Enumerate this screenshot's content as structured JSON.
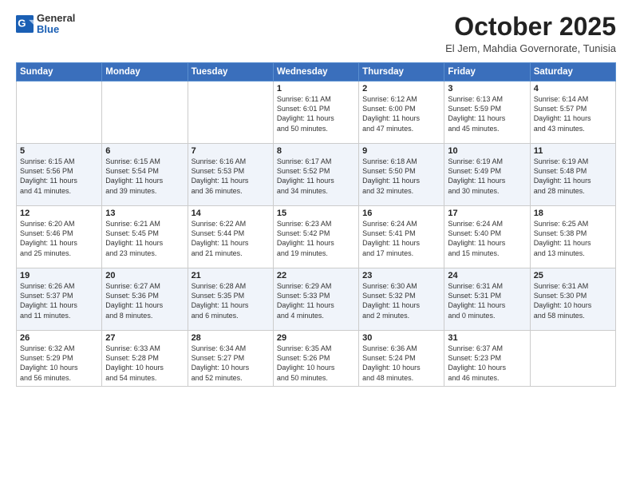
{
  "header": {
    "logo_general": "General",
    "logo_blue": "Blue",
    "month_title": "October 2025",
    "subtitle": "El Jem, Mahdia Governorate, Tunisia"
  },
  "weekdays": [
    "Sunday",
    "Monday",
    "Tuesday",
    "Wednesday",
    "Thursday",
    "Friday",
    "Saturday"
  ],
  "weeks": [
    [
      {
        "day": "",
        "text": ""
      },
      {
        "day": "",
        "text": ""
      },
      {
        "day": "",
        "text": ""
      },
      {
        "day": "1",
        "text": "Sunrise: 6:11 AM\nSunset: 6:01 PM\nDaylight: 11 hours\nand 50 minutes."
      },
      {
        "day": "2",
        "text": "Sunrise: 6:12 AM\nSunset: 6:00 PM\nDaylight: 11 hours\nand 47 minutes."
      },
      {
        "day": "3",
        "text": "Sunrise: 6:13 AM\nSunset: 5:59 PM\nDaylight: 11 hours\nand 45 minutes."
      },
      {
        "day": "4",
        "text": "Sunrise: 6:14 AM\nSunset: 5:57 PM\nDaylight: 11 hours\nand 43 minutes."
      }
    ],
    [
      {
        "day": "5",
        "text": "Sunrise: 6:15 AM\nSunset: 5:56 PM\nDaylight: 11 hours\nand 41 minutes."
      },
      {
        "day": "6",
        "text": "Sunrise: 6:15 AM\nSunset: 5:54 PM\nDaylight: 11 hours\nand 39 minutes."
      },
      {
        "day": "7",
        "text": "Sunrise: 6:16 AM\nSunset: 5:53 PM\nDaylight: 11 hours\nand 36 minutes."
      },
      {
        "day": "8",
        "text": "Sunrise: 6:17 AM\nSunset: 5:52 PM\nDaylight: 11 hours\nand 34 minutes."
      },
      {
        "day": "9",
        "text": "Sunrise: 6:18 AM\nSunset: 5:50 PM\nDaylight: 11 hours\nand 32 minutes."
      },
      {
        "day": "10",
        "text": "Sunrise: 6:19 AM\nSunset: 5:49 PM\nDaylight: 11 hours\nand 30 minutes."
      },
      {
        "day": "11",
        "text": "Sunrise: 6:19 AM\nSunset: 5:48 PM\nDaylight: 11 hours\nand 28 minutes."
      }
    ],
    [
      {
        "day": "12",
        "text": "Sunrise: 6:20 AM\nSunset: 5:46 PM\nDaylight: 11 hours\nand 25 minutes."
      },
      {
        "day": "13",
        "text": "Sunrise: 6:21 AM\nSunset: 5:45 PM\nDaylight: 11 hours\nand 23 minutes."
      },
      {
        "day": "14",
        "text": "Sunrise: 6:22 AM\nSunset: 5:44 PM\nDaylight: 11 hours\nand 21 minutes."
      },
      {
        "day": "15",
        "text": "Sunrise: 6:23 AM\nSunset: 5:42 PM\nDaylight: 11 hours\nand 19 minutes."
      },
      {
        "day": "16",
        "text": "Sunrise: 6:24 AM\nSunset: 5:41 PM\nDaylight: 11 hours\nand 17 minutes."
      },
      {
        "day": "17",
        "text": "Sunrise: 6:24 AM\nSunset: 5:40 PM\nDaylight: 11 hours\nand 15 minutes."
      },
      {
        "day": "18",
        "text": "Sunrise: 6:25 AM\nSunset: 5:38 PM\nDaylight: 11 hours\nand 13 minutes."
      }
    ],
    [
      {
        "day": "19",
        "text": "Sunrise: 6:26 AM\nSunset: 5:37 PM\nDaylight: 11 hours\nand 11 minutes."
      },
      {
        "day": "20",
        "text": "Sunrise: 6:27 AM\nSunset: 5:36 PM\nDaylight: 11 hours\nand 8 minutes."
      },
      {
        "day": "21",
        "text": "Sunrise: 6:28 AM\nSunset: 5:35 PM\nDaylight: 11 hours\nand 6 minutes."
      },
      {
        "day": "22",
        "text": "Sunrise: 6:29 AM\nSunset: 5:33 PM\nDaylight: 11 hours\nand 4 minutes."
      },
      {
        "day": "23",
        "text": "Sunrise: 6:30 AM\nSunset: 5:32 PM\nDaylight: 11 hours\nand 2 minutes."
      },
      {
        "day": "24",
        "text": "Sunrise: 6:31 AM\nSunset: 5:31 PM\nDaylight: 11 hours\nand 0 minutes."
      },
      {
        "day": "25",
        "text": "Sunrise: 6:31 AM\nSunset: 5:30 PM\nDaylight: 10 hours\nand 58 minutes."
      }
    ],
    [
      {
        "day": "26",
        "text": "Sunrise: 6:32 AM\nSunset: 5:29 PM\nDaylight: 10 hours\nand 56 minutes."
      },
      {
        "day": "27",
        "text": "Sunrise: 6:33 AM\nSunset: 5:28 PM\nDaylight: 10 hours\nand 54 minutes."
      },
      {
        "day": "28",
        "text": "Sunrise: 6:34 AM\nSunset: 5:27 PM\nDaylight: 10 hours\nand 52 minutes."
      },
      {
        "day": "29",
        "text": "Sunrise: 6:35 AM\nSunset: 5:26 PM\nDaylight: 10 hours\nand 50 minutes."
      },
      {
        "day": "30",
        "text": "Sunrise: 6:36 AM\nSunset: 5:24 PM\nDaylight: 10 hours\nand 48 minutes."
      },
      {
        "day": "31",
        "text": "Sunrise: 6:37 AM\nSunset: 5:23 PM\nDaylight: 10 hours\nand 46 minutes."
      },
      {
        "day": "",
        "text": ""
      }
    ]
  ]
}
